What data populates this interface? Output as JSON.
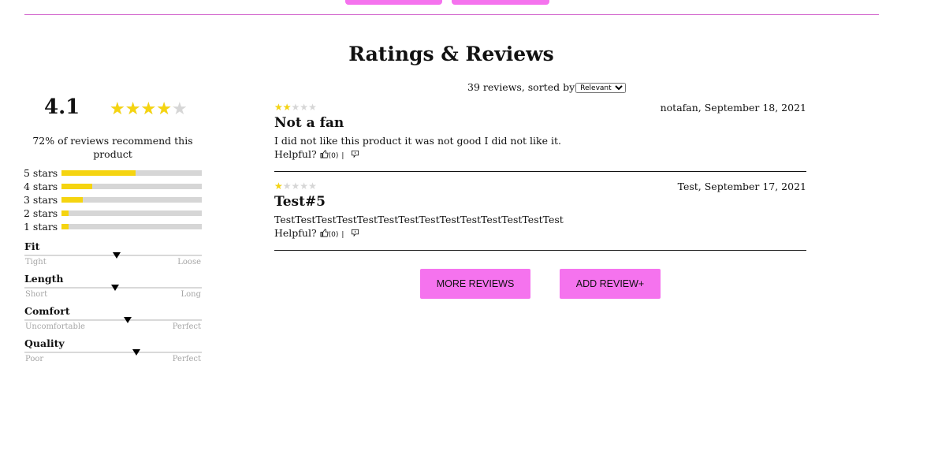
{
  "header": {
    "title": "Ratings & Reviews"
  },
  "colors": {
    "accent": "#f573ee",
    "star_filled": "#f5d410",
    "star_empty": "#d6d6d6"
  },
  "summary": {
    "average": "4.1",
    "average_value": 4.1,
    "recommend_text": "72% of reviews recommend this product",
    "breakdown": [
      {
        "label": "5 stars",
        "fraction": 0.53
      },
      {
        "label": "4 stars",
        "fraction": 0.22
      },
      {
        "label": "3 stars",
        "fraction": 0.15
      },
      {
        "label": "2 stars",
        "fraction": 0.05
      },
      {
        "label": "1 stars",
        "fraction": 0.05
      }
    ],
    "characteristics": [
      {
        "name": "Fit",
        "low": "Tight",
        "high": "Loose",
        "value": 0.52
      },
      {
        "name": "Length",
        "low": "Short",
        "high": "Long",
        "value": 0.51
      },
      {
        "name": "Comfort",
        "low": "Uncomfortable",
        "high": "Perfect",
        "value": 0.58
      },
      {
        "name": "Quality",
        "low": "Poor",
        "high": "Perfect",
        "value": 0.63
      }
    ]
  },
  "list": {
    "sort_prefix": "39 reviews, sorted by",
    "sort_selected": "Relevant"
  },
  "reviews": [
    {
      "rating": 2,
      "meta": "notafan, September 18, 2021",
      "summary": "Not a fan",
      "body": "I did not like this product it was not good I did not like it.",
      "helpful_label": "Helpful?",
      "yes_count": "(0)",
      "divider": "|",
      "up_icon": "thumbs-up-icon",
      "down_icon": "report-icon"
    },
    {
      "rating": 1,
      "meta": "Test, September 17, 2021",
      "summary": "Test#5",
      "body": "TestTestTestTestTestTestTestTestTestTestTestTestTestTest",
      "helpful_label": "Helpful?",
      "yes_count": "(0)",
      "divider": "|",
      "up_icon": "thumbs-up-icon",
      "down_icon": "report-icon"
    }
  ],
  "actions": {
    "more_reviews": "MORE REVIEWS",
    "add_review": "ADD REVIEW+"
  }
}
